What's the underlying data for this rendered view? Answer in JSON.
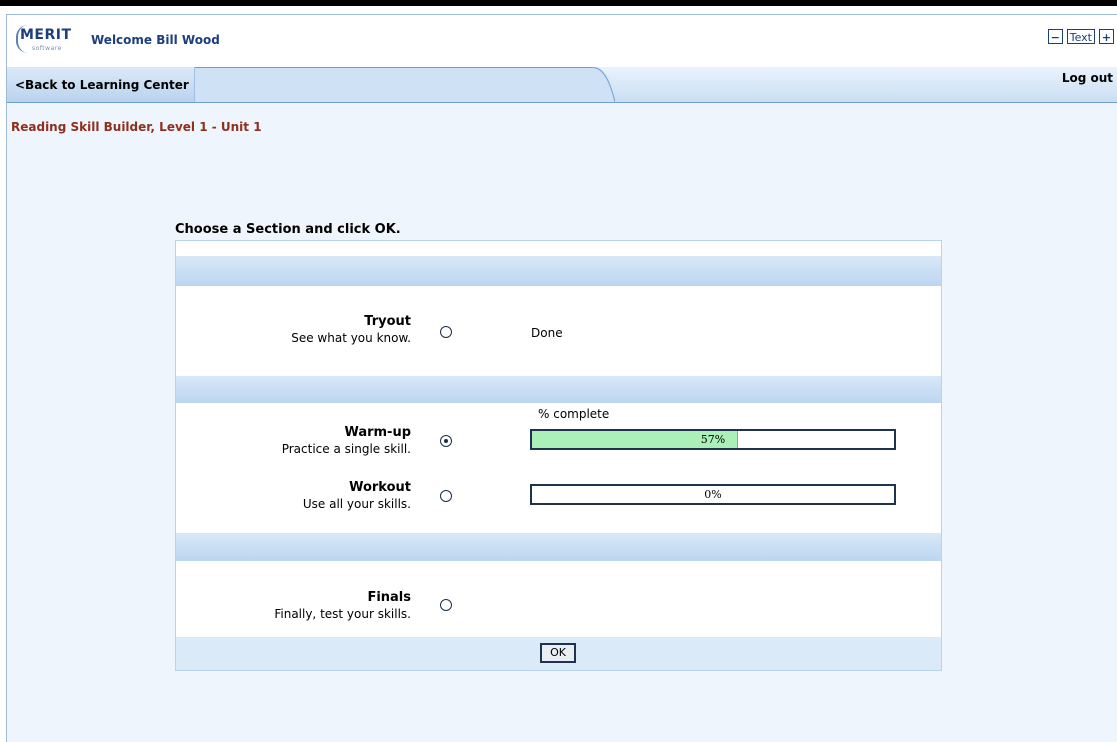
{
  "app": {
    "logo_text": "MERIT",
    "logo_sub": "software",
    "welcome": "Welcome Bill Wood",
    "text_size": {
      "decrease": "−",
      "label": "Text",
      "increase": "+"
    }
  },
  "nav": {
    "back_label": "<Back to Learning Center",
    "logout_label": "Log out"
  },
  "course_title": "Reading Skill Builder, Level 1 - Unit 1",
  "instruction": "Choose a Section and click OK.",
  "sections": {
    "tryout": {
      "title": "Tryout",
      "subtitle": "See what you know.",
      "status": "Done",
      "selected": false
    },
    "progress_header": "% complete",
    "warmup": {
      "title": "Warm-up",
      "subtitle": "Practice a single skill.",
      "progress": 57,
      "progress_label": "57%",
      "selected": true
    },
    "workout": {
      "title": "Workout",
      "subtitle": "Use all your skills.",
      "progress": 0,
      "progress_label": "0%",
      "selected": false
    },
    "finals": {
      "title": "Finals",
      "subtitle": "Finally, test your skills.",
      "selected": false
    }
  },
  "ok_label": "OK",
  "colors": {
    "accent": "#1b3f7e",
    "course_title": "#8e2f1f",
    "progress_fill": "#aaf0b8",
    "band": "#bcd6f0"
  }
}
